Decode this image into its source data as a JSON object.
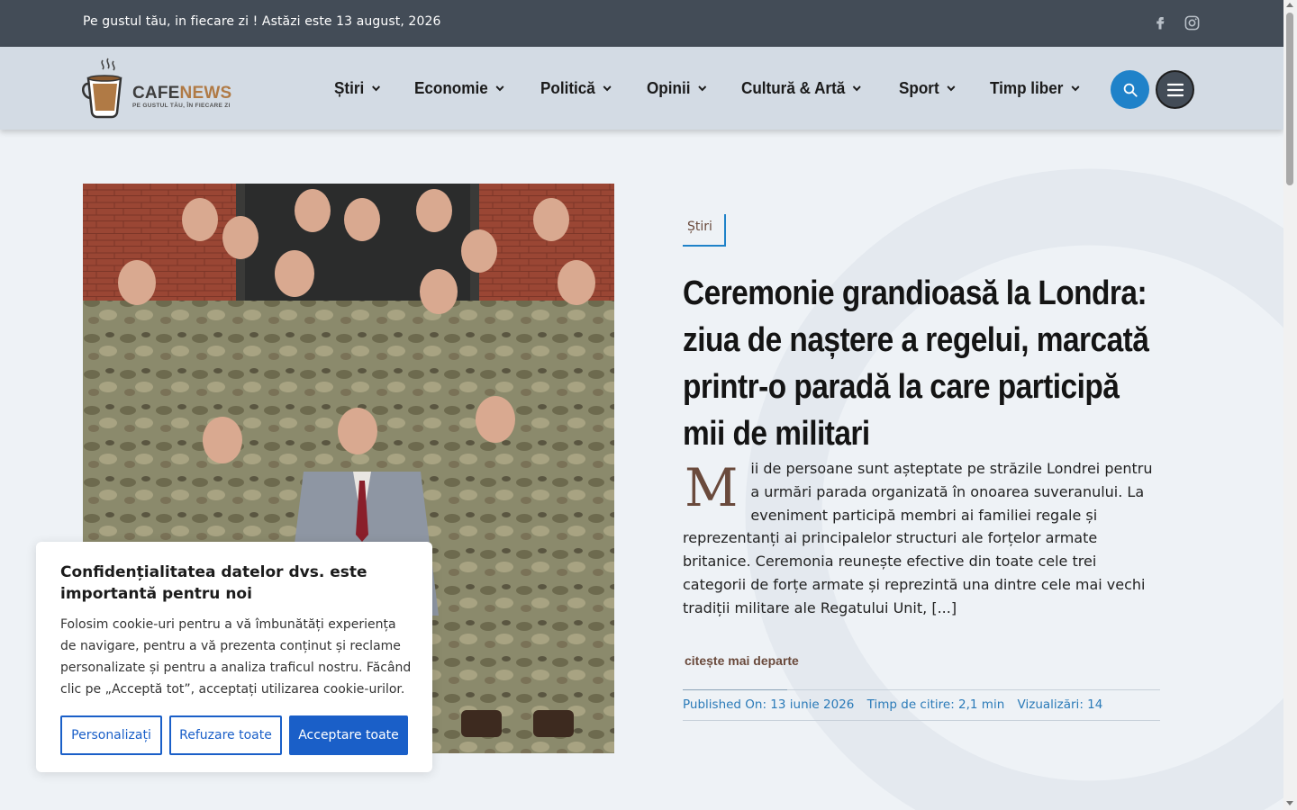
{
  "topbar": {
    "tagline": "Pe gustul tău, in fiecare zi ! Astăzi este 13 august, 2026",
    "social": [
      "facebook-icon",
      "instagram-icon"
    ]
  },
  "logo": {
    "name_part1": "CAFE",
    "name_part2": "NEWS",
    "slogan": "PE GUSTUL TĂU, ÎN FIECARE ZI"
  },
  "nav": {
    "items": [
      {
        "label": "Știri"
      },
      {
        "label": "Economie"
      },
      {
        "label": "Politică"
      },
      {
        "label": "Opinii"
      },
      {
        "label": "Cultură & Artă"
      },
      {
        "label": "Sport"
      },
      {
        "label": "Timp liber"
      }
    ]
  },
  "colors": {
    "accent": "#1f82c9",
    "brand_brown": "#6a4a3c",
    "topbar": "#434c57",
    "header": "#d3dbe4",
    "cookie_button": "#1a5fc8"
  },
  "article": {
    "category": "Știri",
    "title": "Ceremonie grandioasă la Londra: ziua de naștere a regelui, marcată printr-o paradă la care participă mii de militari",
    "dropcap": "M",
    "excerpt": "ii de persoane sunt așteptate pe străzile Londrei pentru a urmări parada organizată în onoarea suveranului. La eveniment participă membri ai familiei regale și reprezentanți ai principalelor structuri ale forțelor armate britanice. Ceremonia reunește efective din toate cele trei categorii de forțe armate și reprezintă una dintre cele mai vechi tradiții militare ale Regatului Unit, [...]",
    "read_more": "citește mai departe",
    "meta": {
      "published": "Published On: 13 iunie 2026",
      "reading_time": "Timp de citire: 2,1 min",
      "views": "Vizualizări: 14"
    }
  },
  "cookie": {
    "title": "Confidențialitatea datelor dvs. este importantă pentru noi",
    "text": "Folosim cookie-uri pentru a vă îmbunătăți experiența de navigare, pentru a vă prezenta conținut și reclame personalizate și pentru a analiza traficul nostru. Făcând clic pe „Acceptă tot”, acceptați utilizarea cookie-urilor.",
    "customize": "Personalizați",
    "reject": "Refuzare toate",
    "accept": "Acceptare toate"
  }
}
